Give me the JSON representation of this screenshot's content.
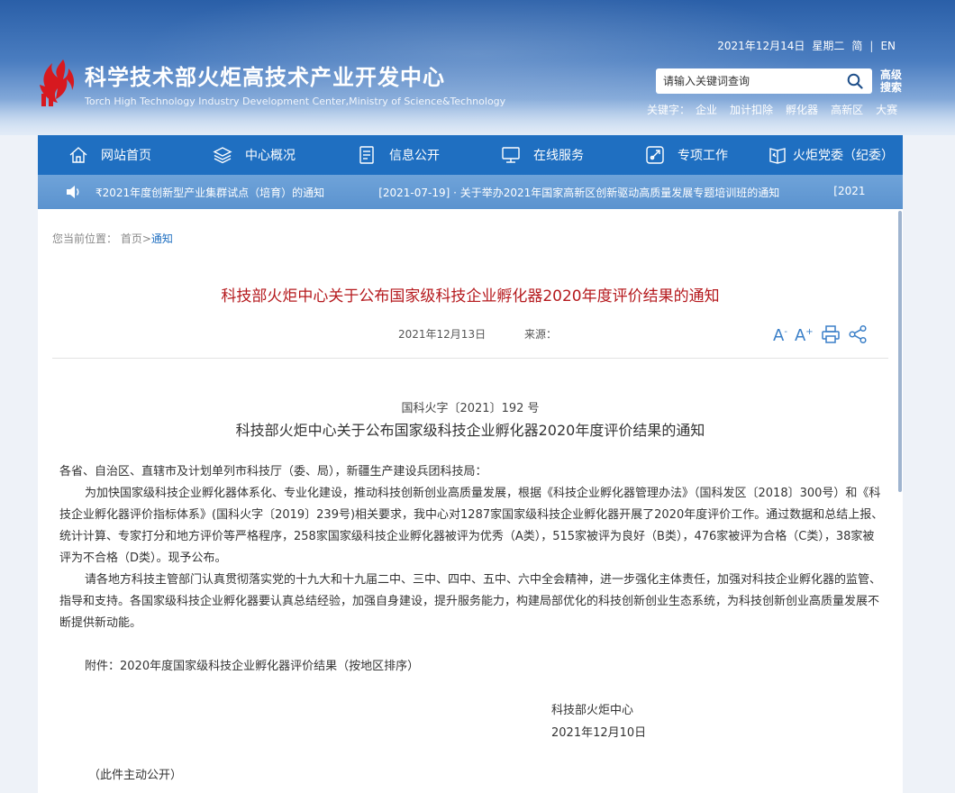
{
  "header": {
    "site_title": "科学技术部火炬高技术产业开发中心",
    "site_subtitle": "Torch High Technology Industry Development Center,Ministry of Science&Technology",
    "date": "2021年12月14日",
    "weekday": "星期二",
    "lang_simplified": "简",
    "lang_separator": "|",
    "lang_english": "EN",
    "search_placeholder": "请输入关键词查询",
    "advanced_search": "高级搜索",
    "keywords_label": "关键字：",
    "keywords": [
      "企业",
      "加计扣除",
      "孵化器",
      "高新区",
      "大赛"
    ]
  },
  "nav": {
    "items": [
      {
        "label": "网站首页",
        "icon": "home-icon"
      },
      {
        "label": "中心概况",
        "icon": "layers-icon"
      },
      {
        "label": "信息公开",
        "icon": "document-icon"
      },
      {
        "label": "在线服务",
        "icon": "monitor-icon"
      },
      {
        "label": "专项工作",
        "icon": "rocket-icon"
      },
      {
        "label": "火炬党委（纪委）",
        "icon": "party-book-icon"
      }
    ]
  },
  "ticker": {
    "items": [
      "₹2021年度创新型产业集群试点（培育）的通知",
      "[2021-07-19] · 关于举办2021年国家高新区创新驱动高质量发展专题培训班的通知",
      "[2021"
    ]
  },
  "breadcrumb": {
    "label": "您当前位置：",
    "home": "首页",
    "separator": ">",
    "current": "通知"
  },
  "article": {
    "title": "科技部火炬中心关于公布国家级科技企业孵化器2020年度评价结果的通知",
    "date": "2021年12月13日",
    "source_label": "来源：",
    "tools": {
      "font_smaller": "A",
      "font_larger": "A"
    },
    "doc_number": "国科火字〔2021〕192 号",
    "doc_title": "科技部火炬中心关于公布国家级科技企业孵化器2020年度评价结果的通知",
    "salutation": "各省、自治区、直辖市及计划单列市科技厅（委、局），新疆生产建设兵团科技局：",
    "paragraph1": "为加快国家级科技企业孵化器体系化、专业化建设，推动科技创新创业高质量发展，根据《科技企业孵化器管理办法》（国科发区〔2018〕300号）和《科技企业孵化器评价指标体系》(国科火字〔2019〕239号)相关要求，我中心对1287家国家级科技企业孵化器开展了2020年度评价工作。通过数据和总结上报、统计计算、专家打分和地方评价等严格程序，258家国家级科技企业孵化器被评为优秀（A类），515家被评为良好（B类），476家被评为合格（C类），38家被评为不合格（D类）。现予公布。",
    "paragraph2": "请各地方科技主管部门认真贯彻落实党的十九大和十九届二中、三中、四中、五中、六中全会精神，进一步强化主体责任，加强对科技企业孵化器的监管、指导和支持。各国家级科技企业孵化器要认真总结经验，加强自身建设，提升服务能力，构建局部优化的科技创新创业生态系统，为科技创新创业高质量发展不断提供新动能。",
    "attachment": "附件：2020年度国家级科技企业孵化器评价结果（按地区排序）",
    "sign_org": "科技部火炬中心",
    "sign_date": "2021年12月10日",
    "public_note": "（此件主动公开）"
  },
  "colors": {
    "nav_bg": "#1f6fc1",
    "ticker_bg": "#5b93cf",
    "title_red": "#b5191d",
    "logo_red": "#d7191f"
  }
}
